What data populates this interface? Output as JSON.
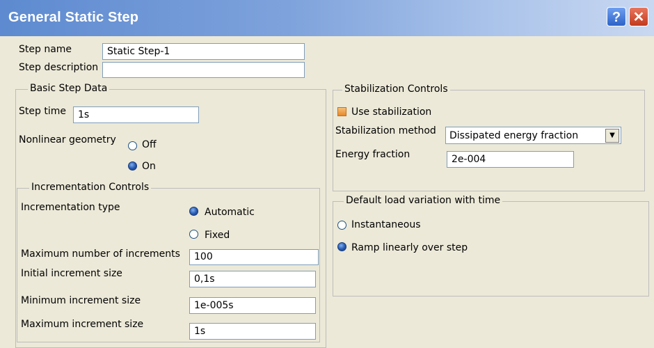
{
  "window": {
    "title": "General Static Step",
    "help_glyph": "?",
    "close_glyph": "✕"
  },
  "step": {
    "name_label": "Step name",
    "name_value": "Static Step-1",
    "description_label": "Step description",
    "description_value": ""
  },
  "basic": {
    "legend": "Basic Step Data",
    "step_time_label": "Step time",
    "step_time_value": "1s",
    "nlgeom_label": "Nonlinear geometry",
    "nlgeom_off": "Off",
    "nlgeom_on": "On",
    "nlgeom_selected": "On"
  },
  "incrementation": {
    "legend": "Incrementation Controls",
    "type_label": "Incrementation type",
    "automatic": "Automatic",
    "fixed": "Fixed",
    "selected": "Automatic",
    "max_num_label": "Maximum number of increments",
    "max_num_value": "100",
    "initial_label": "Initial increment size",
    "initial_value": "0,1s",
    "min_label": "Minimum increment size",
    "min_value": "1e-005s",
    "max_label": "Maximum increment size",
    "max_value": "1s"
  },
  "stabilization": {
    "legend": "Stabilization Controls",
    "use_label": "Use stabilization",
    "use_checked": true,
    "method_label": "Stabilization method",
    "method_value": "Dissipated energy fraction",
    "energy_label": "Energy fraction",
    "energy_value": "2e-004"
  },
  "load": {
    "legend": "Default load variation with time",
    "instantaneous": "Instantaneous",
    "ramp": "Ramp linearly over step",
    "selected": "Ramp linearly over step"
  },
  "colors": {
    "title_start": "#5d8ad0",
    "title_end": "#c9d8f1",
    "face": "#ece9d8",
    "field_border": "#7f9db9"
  }
}
